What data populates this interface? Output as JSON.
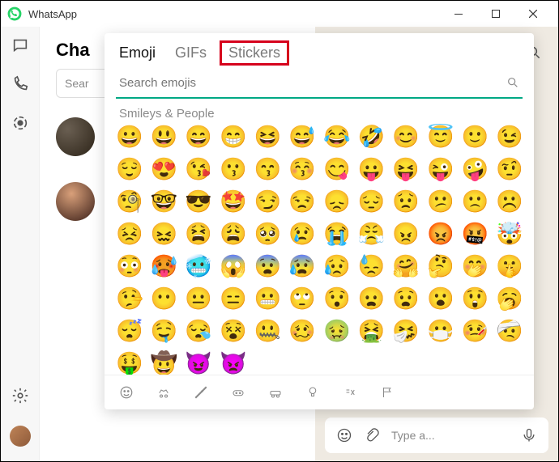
{
  "window": {
    "title": "WhatsApp"
  },
  "chats": {
    "title": "Cha",
    "search_placeholder": "Sear"
  },
  "message_bar": {
    "placeholder": "Type a..."
  },
  "picker": {
    "tabs": {
      "emoji": "Emoji",
      "gifs": "GIFs",
      "stickers": "Stickers"
    },
    "search_placeholder": "Search emojis",
    "category_label": "Smileys & People",
    "emojis": [
      "😀",
      "😃",
      "😄",
      "😁",
      "😆",
      "😅",
      "😂",
      "🤣",
      "😊",
      "😇",
      "🙂",
      "😉",
      "😌",
      "😍",
      "😘",
      "😗",
      "😙",
      "😚",
      "😋",
      "😛",
      "😝",
      "😜",
      "🤪",
      "🤨",
      "🧐",
      "🤓",
      "😎",
      "🤩",
      "😏",
      "😒",
      "😞",
      "😔",
      "😟",
      "😕",
      "🙁",
      "☹️",
      "😣",
      "😖",
      "😫",
      "😩",
      "🥺",
      "😢",
      "😭",
      "😤",
      "😠",
      "😡",
      "🤬",
      "🤯",
      "😳",
      "🥵",
      "🥶",
      "😱",
      "😨",
      "😰",
      "😥",
      "😓",
      "🤗",
      "🤔",
      "🤭",
      "🤫",
      "🤥",
      "😶",
      "😐",
      "😑",
      "😬",
      "🙄",
      "😯",
      "😦",
      "😧",
      "😮",
      "😲",
      "🥱",
      "😴",
      "🤤",
      "😪",
      "😵",
      "🤐",
      "🥴",
      "🤢",
      "🤮",
      "🤧",
      "😷",
      "🤒",
      "🤕",
      "🤑",
      "🤠",
      "😈",
      "👿"
    ]
  }
}
